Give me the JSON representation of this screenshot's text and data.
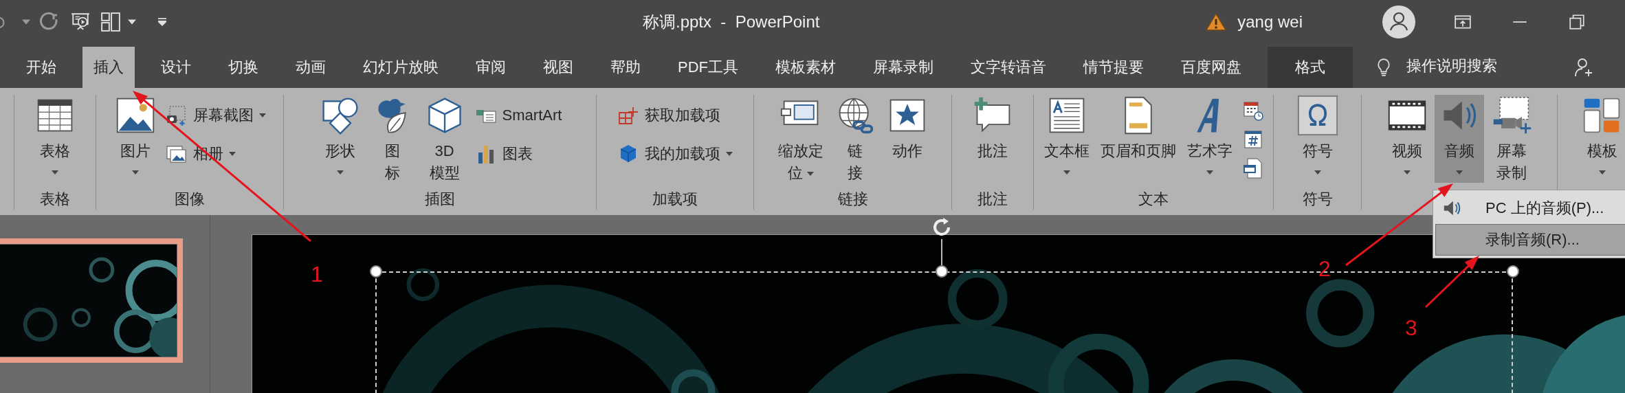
{
  "window": {
    "title": "称调.pptx  -  PowerPoint",
    "user": "yang wei"
  },
  "tabs": [
    {
      "label": "开始",
      "selected": false,
      "contextual": false
    },
    {
      "label": "插入",
      "selected": true,
      "contextual": false
    },
    {
      "label": "设计",
      "selected": false,
      "contextual": false
    },
    {
      "label": "切换",
      "selected": false,
      "contextual": false
    },
    {
      "label": "动画",
      "selected": false,
      "contextual": false
    },
    {
      "label": "幻灯片放映",
      "selected": false,
      "contextual": false
    },
    {
      "label": "审阅",
      "selected": false,
      "contextual": false
    },
    {
      "label": "视图",
      "selected": false,
      "contextual": false
    },
    {
      "label": "帮助",
      "selected": false,
      "contextual": false
    },
    {
      "label": "PDF工具",
      "selected": false,
      "contextual": false
    },
    {
      "label": "模板素材",
      "selected": false,
      "contextual": false
    },
    {
      "label": "屏幕录制",
      "selected": false,
      "contextual": false
    },
    {
      "label": "文字转语音",
      "selected": false,
      "contextual": false
    },
    {
      "label": "情节提要",
      "selected": false,
      "contextual": false
    },
    {
      "label": "百度网盘",
      "selected": false,
      "contextual": false
    },
    {
      "label": "格式",
      "selected": false,
      "contextual": true
    }
  ],
  "tell_me": "操作说明搜索",
  "ribbon": {
    "groups": [
      {
        "label": "表格",
        "commands": [
          {
            "kind": "large",
            "lines": [
              "表格"
            ],
            "dropdown": true,
            "pressed": false
          }
        ]
      },
      {
        "label": "图像",
        "commands": [
          {
            "kind": "large",
            "lines": [
              "图片"
            ],
            "dropdown": true,
            "pressed": false
          },
          {
            "kind": "stack",
            "items": [
              {
                "kind": "small",
                "lines": [
                  "屏幕截图"
                ],
                "dropdown": true,
                "pressed": false
              },
              {
                "kind": "small",
                "lines": [
                  "相册"
                ],
                "dropdown": true,
                "pressed": false
              }
            ]
          }
        ]
      },
      {
        "label": "插图",
        "commands": [
          {
            "kind": "large",
            "lines": [
              "形状"
            ],
            "dropdown": true,
            "pressed": false
          },
          {
            "kind": "large",
            "lines": [
              "图",
              "标"
            ],
            "dropdown": false,
            "pressed": false
          },
          {
            "kind": "large",
            "lines": [
              "3D",
              "模型"
            ],
            "dropdown": false,
            "pressed": false
          },
          {
            "kind": "stack",
            "items": [
              {
                "kind": "small",
                "lines": [
                  "SmartArt"
                ],
                "dropdown": false,
                "pressed": false
              },
              {
                "kind": "small",
                "lines": [
                  "图表"
                ],
                "dropdown": false,
                "pressed": false
              }
            ]
          }
        ]
      },
      {
        "label": "加载项",
        "commands": [
          {
            "kind": "stack",
            "items": [
              {
                "kind": "small",
                "lines": [
                  "获取加载项"
                ],
                "dropdown": false,
                "pressed": false
              },
              {
                "kind": "small",
                "lines": [
                  "我的加载项"
                ],
                "dropdown": true,
                "pressed": false
              }
            ]
          }
        ]
      },
      {
        "label": "链接",
        "commands": [
          {
            "kind": "large",
            "lines": [
              "缩放定",
              "位"
            ],
            "dropdown": true,
            "pressed": false
          },
          {
            "kind": "large",
            "lines": [
              "链",
              "接"
            ],
            "dropdown": false,
            "pressed": false
          },
          {
            "kind": "large",
            "lines": [
              "动作"
            ],
            "dropdown": false,
            "pressed": false
          }
        ]
      },
      {
        "label": "批注",
        "commands": [
          {
            "kind": "large",
            "lines": [
              "批注"
            ],
            "dropdown": false,
            "pressed": false
          }
        ]
      },
      {
        "label": "文本",
        "commands": [
          {
            "kind": "large",
            "lines": [
              "文本框"
            ],
            "dropdown": true,
            "pressed": false
          },
          {
            "kind": "large",
            "lines": [
              "页眉和页脚"
            ],
            "dropdown": false,
            "pressed": false
          },
          {
            "kind": "large",
            "lines": [
              "艺术字"
            ],
            "dropdown": true,
            "pressed": false
          },
          {
            "kind": "stack",
            "items": [
              {
                "kind": "icon",
                "pressed": false
              },
              {
                "kind": "icon",
                "pressed": false
              },
              {
                "kind": "icon",
                "pressed": false
              }
            ]
          }
        ]
      },
      {
        "label": "符号",
        "commands": [
          {
            "kind": "large",
            "lines": [
              "符号"
            ],
            "dropdown": true,
            "pressed": false
          }
        ]
      },
      {
        "commands": [
          {
            "kind": "large",
            "lines": [
              "视频"
            ],
            "dropdown": true,
            "pressed": false
          },
          {
            "kind": "large",
            "lines": [
              "音频"
            ],
            "dropdown": true,
            "pressed": true
          },
          {
            "kind": "large",
            "lines": [
              "屏幕",
              "录制"
            ],
            "dropdown": false,
            "pressed": false
          }
        ]
      },
      {
        "commands": [
          {
            "kind": "large",
            "lines": [
              "模板"
            ],
            "dropdown": true,
            "pressed": false
          }
        ]
      }
    ]
  },
  "menu": {
    "items": [
      {
        "label": "PC 上的音频(P)...",
        "highlighted": false
      },
      {
        "label": "录制音频(R)...",
        "highlighted": true
      }
    ]
  },
  "annotations": [
    {
      "label": "1"
    },
    {
      "label": "2"
    },
    {
      "label": "3"
    }
  ]
}
